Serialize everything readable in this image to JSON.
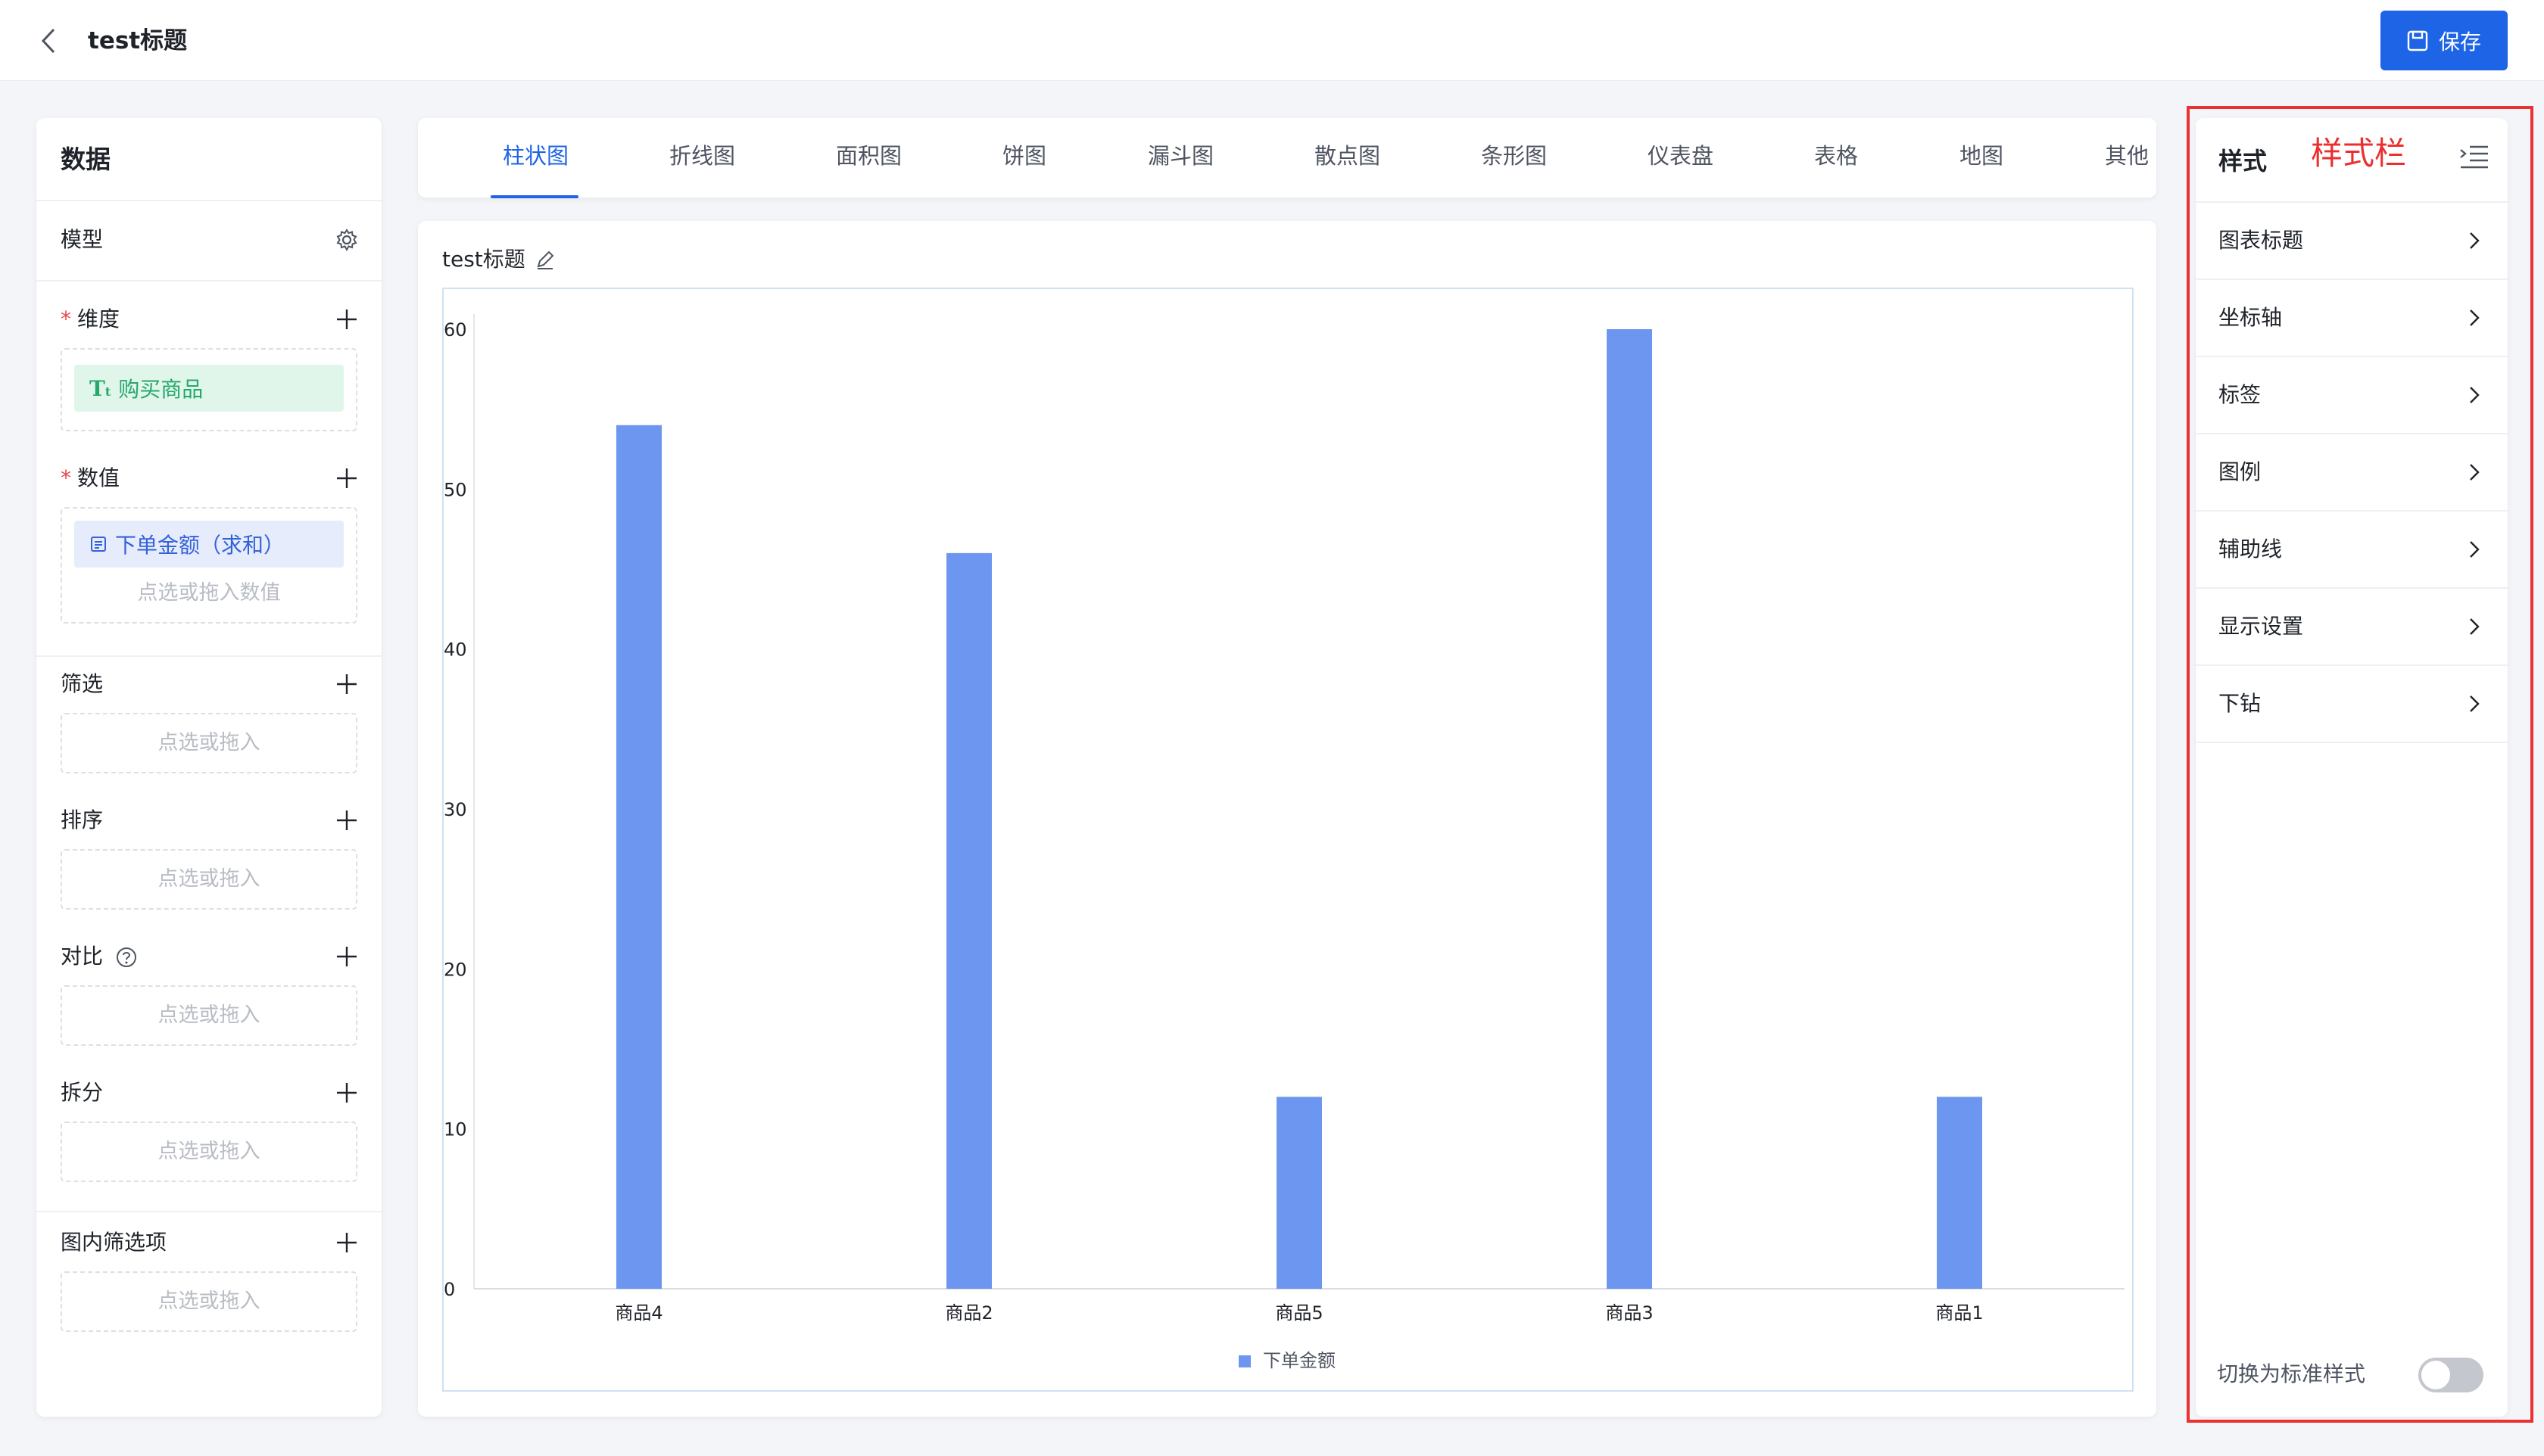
{
  "header": {
    "title": "test标题",
    "save_label": "保存"
  },
  "left_panel": {
    "title": "数据",
    "model_label": "模型",
    "dimension": {
      "label": "维度",
      "chip": "购买商品"
    },
    "value": {
      "label": "数值",
      "chip": "下单金额（求和）",
      "hint": "点选或拖入数值"
    },
    "filter": {
      "label": "筛选",
      "hint": "点选或拖入"
    },
    "sort": {
      "label": "排序",
      "hint": "点选或拖入"
    },
    "compare": {
      "label": "对比",
      "hint": "点选或拖入"
    },
    "split": {
      "label": "拆分",
      "hint": "点选或拖入"
    },
    "inner_filter": {
      "label": "图内筛选项",
      "hint": "点选或拖入"
    }
  },
  "tabs": [
    {
      "label": "柱状图",
      "active": true
    },
    {
      "label": "折线图"
    },
    {
      "label": "面积图"
    },
    {
      "label": "饼图"
    },
    {
      "label": "漏斗图"
    },
    {
      "label": "散点图"
    },
    {
      "label": "条形图"
    },
    {
      "label": "仪表盘"
    },
    {
      "label": "表格"
    },
    {
      "label": "地图"
    },
    {
      "label": "其他"
    }
  ],
  "chart_panel": {
    "title": "test标题"
  },
  "chart_data": {
    "type": "bar",
    "categories": [
      "商品4",
      "商品2",
      "商品5",
      "商品3",
      "商品1"
    ],
    "series": [
      {
        "name": "下单金额",
        "values": [
          54,
          46,
          12,
          60,
          12
        ],
        "color": "#6d96f0"
      }
    ],
    "ylim": [
      0,
      60
    ],
    "yticks": [
      0,
      10,
      20,
      30,
      40,
      50,
      60
    ],
    "legend_position": "bottom-center",
    "grid": false
  },
  "right_panel": {
    "title": "样式",
    "annotation": "样式栏",
    "items": [
      {
        "label": "图表标题"
      },
      {
        "label": "坐标轴"
      },
      {
        "label": "标签"
      },
      {
        "label": "图例"
      },
      {
        "label": "辅助线"
      },
      {
        "label": "显示设置"
      },
      {
        "label": "下钻"
      }
    ],
    "toggle_label": "切换为标准样式",
    "toggle_on": false
  },
  "colors": {
    "accent": "#1e64e6",
    "bar": "#6d96f0",
    "annotation_red": "#ea3232"
  }
}
